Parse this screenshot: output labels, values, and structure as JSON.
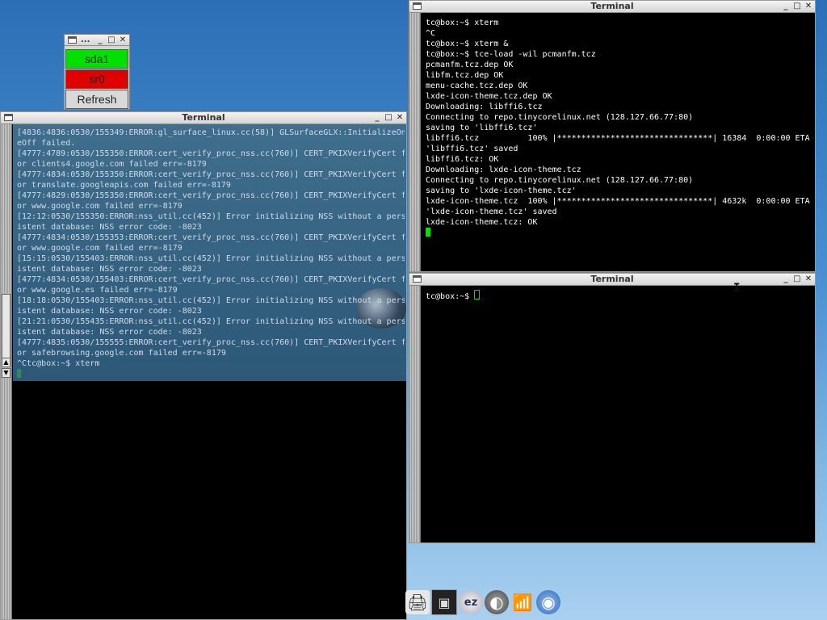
{
  "mount_tool": {
    "title": "...",
    "buttons": [
      {
        "label": "sda1",
        "color": "#00e000"
      },
      {
        "label": "sr0",
        "color": "#e00000"
      },
      {
        "label": "Refresh",
        "color": "#d9d9d9"
      }
    ]
  },
  "left_terminal": {
    "title": "Terminal",
    "lines": [
      "[4836:4836:0530/155349:ERROR:gl_surface_linux.cc(58)] GLSurfaceGLX::InitializeOn",
      "eOff failed.",
      "[4777:4789:0530/155350:ERROR:cert_verify_proc_nss.cc(760)] CERT_PKIXVerifyCert f",
      "or clients4.google.com failed err=-8179",
      "[4777:4834:0530/155350:ERROR:cert_verify_proc_nss.cc(760)] CERT_PKIXVerifyCert f",
      "or translate.googleapis.com failed err=-8179",
      "[4777:4829:0530/155350:ERROR:cert_verify_proc_nss.cc(760)] CERT_PKIXVerifyCert f",
      "or www.google.com failed err=-8179",
      "[12:12:0530/155350:ERROR:nss_util.cc(452)] Error initializing NSS without a pers",
      "istent database: NSS error code: -8023",
      "[4777:4834:0530/155353:ERROR:cert_verify_proc_nss.cc(760)] CERT_PKIXVerifyCert f",
      "or www.google.com failed err=-8179",
      "[15:15:0530/155403:ERROR:nss_util.cc(452)] Error initializing NSS without a pers",
      "istent database: NSS error code: -8023",
      "[4777:4834:0530/155403:ERROR:cert_verify_proc_nss.cc(760)] CERT_PKIXVerifyCert f",
      "or www.google.es failed err=-8179",
      "[18:18:0530/155403:ERROR:nss_util.cc(452)] Error initializing NSS without a pers",
      "istent database: NSS error code: -8023",
      "[21:21:0530/155435:ERROR:nss_util.cc(452)] Error initializing NSS without a pers",
      "istent database: NSS error code: -8023",
      "[4777:4835:0530/155555:ERROR:cert_verify_proc_nss.cc(760)] CERT_PKIXVerifyCert f",
      "or safebrowsing.google.com failed err=-8179",
      "^Ctc@box:~$ xterm"
    ],
    "text_color": "#c8d8e8"
  },
  "top_right_terminal": {
    "title": "Terminal",
    "lines": [
      "tc@box:~$ xterm",
      "^C",
      "tc@box:~$ xterm &",
      "tc@box:~$ tce-load -wil pcmanfm.tcz",
      "pcmanfm.tcz.dep OK",
      "libfm.tcz.dep OK",
      "menu-cache.tcz.dep OK",
      "lxde-icon-theme.tcz.dep OK",
      "Downloading: libffi6.tcz",
      "Connecting to repo.tinycorelinux.net (128.127.66.77:80)",
      "saving to 'libffi6.tcz'",
      "libffi6.tcz          100% |********************************| 16384  0:00:00 ETA",
      "'libffi6.tcz' saved",
      "libffi6.tcz: OK",
      "Downloading: lxde-icon-theme.tcz",
      "Connecting to repo.tinycorelinux.net (128.127.66.77:80)",
      "saving to 'lxde-icon-theme.tcz'",
      "lxde-icon-theme.tcz  100% |********************************| 4632k  0:00:00 ETA",
      "'lxde-icon-theme.tcz' saved",
      "lxde-icon-theme.tcz: OK"
    ]
  },
  "bottom_right_terminal": {
    "title": "Terminal",
    "prompt": "tc@box:~$ "
  },
  "window_buttons": {
    "minimize": "_",
    "maximize": "□",
    "close": "✕"
  },
  "dock": [
    {
      "name": "printer-icon",
      "glyph": "🖨"
    },
    {
      "name": "terminal-icon",
      "glyph": "▣"
    },
    {
      "name": "ezremaster-icon",
      "glyph": "ez"
    },
    {
      "name": "compass-icon",
      "glyph": "◐"
    },
    {
      "name": "wireless-icon",
      "glyph": "📶"
    },
    {
      "name": "chromium-icon",
      "glyph": "◉"
    }
  ]
}
